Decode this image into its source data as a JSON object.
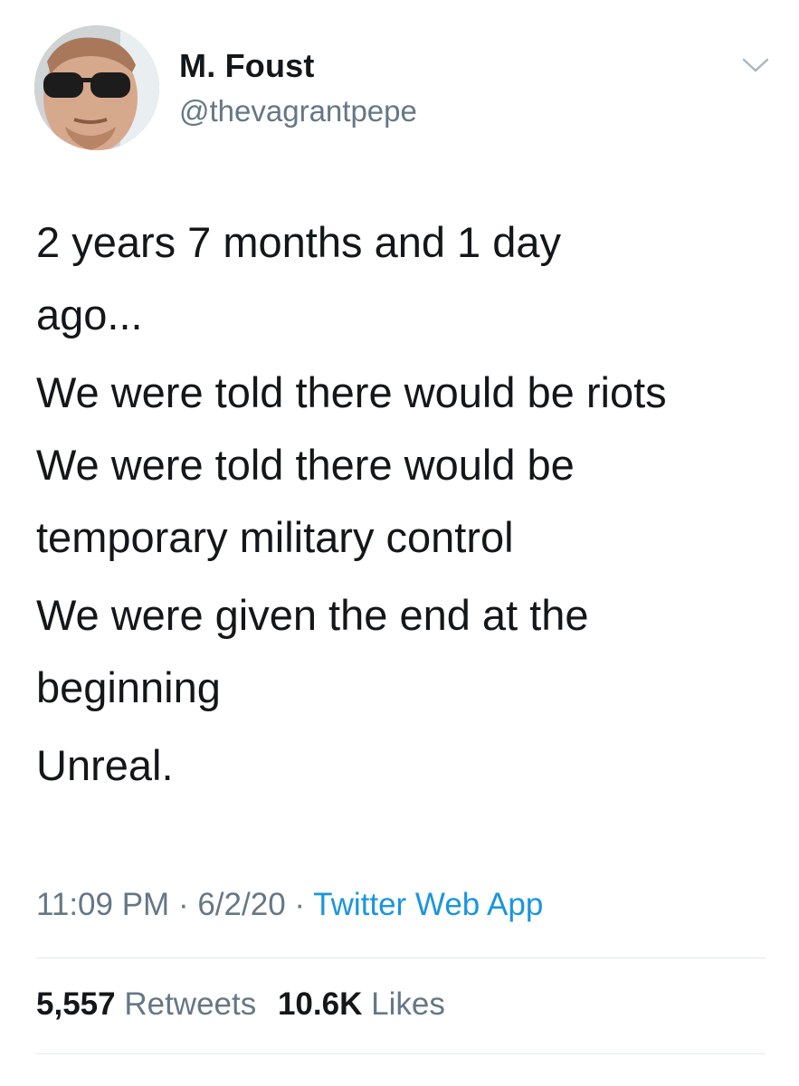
{
  "tweet": {
    "author": {
      "display_name": "M. Foust",
      "handle": "@thevagrantpepe"
    },
    "text_lines": [
      [
        "2 years 7 months and 1 day",
        "ago..."
      ],
      [
        "We were told there would be riots",
        "We were told there would be",
        "temporary military control"
      ],
      [
        "We were given the end at the",
        "beginning"
      ],
      [
        "Unreal."
      ]
    ],
    "time": "11:09 PM",
    "separator": "·",
    "date": "6/2/20",
    "source": "Twitter Web App",
    "stats": {
      "retweets_count": "5,557",
      "retweets_label": "Retweets",
      "likes_count": "10.6K",
      "likes_label": "Likes"
    },
    "icons": {
      "menu": "chevron-down-icon"
    },
    "colors": {
      "text": "#14171a",
      "secondary": "#657786",
      "link": "#1b95e0",
      "divider": "#e1e8ed"
    }
  }
}
